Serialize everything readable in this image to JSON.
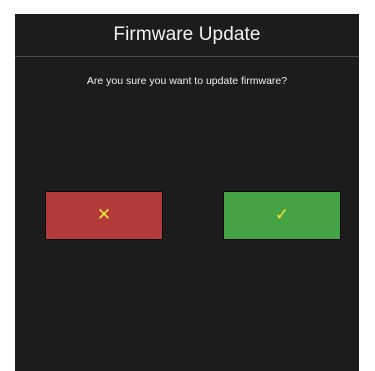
{
  "dialog": {
    "title": "Firmware Update",
    "message": "Are you sure you want to update firmware?"
  },
  "buttons": {
    "cancel": {
      "icon": "close-icon",
      "glyph": "✕"
    },
    "confirm": {
      "icon": "check-icon",
      "glyph": "✓"
    }
  },
  "colors": {
    "background": "#1c1c1c",
    "cancel": "#b23a3a",
    "confirm": "#45a345",
    "icon": "#f2e23a",
    "text": "#f2f2f2"
  }
}
